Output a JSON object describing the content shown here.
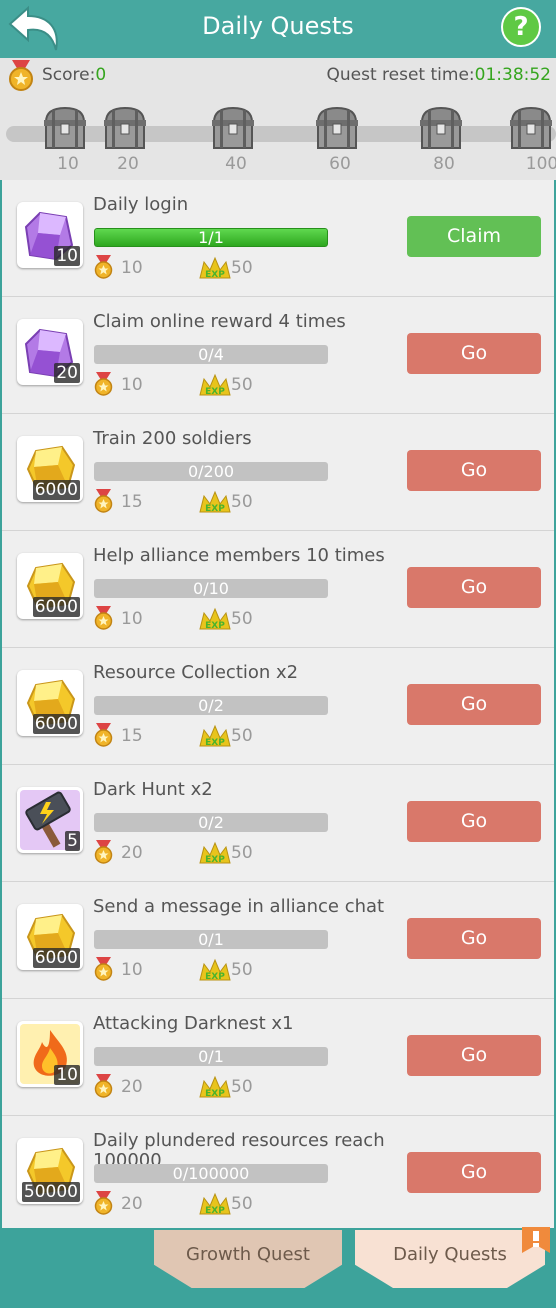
{
  "header": {
    "title": "Daily Quests",
    "help_label": "?"
  },
  "scorebar": {
    "score_label": "Score:",
    "score_value": "0",
    "reset_label": "Quest reset time:",
    "reset_time": "01:38:52"
  },
  "milestones": [
    "10",
    "20",
    "40",
    "60",
    "80",
    "100"
  ],
  "quests": [
    {
      "name": "Daily login",
      "progress": "1/1",
      "progress_fraction": 1,
      "score": "10",
      "exp": "50",
      "reward_icon": "purple-crystal-icon",
      "reward_qty": "10",
      "button": "Claim"
    },
    {
      "name": "Claim online reward 4 times",
      "progress": "0/4",
      "progress_fraction": 0,
      "score": "10",
      "exp": "50",
      "reward_icon": "purple-crystal-icon",
      "reward_qty": "20",
      "button": "Go"
    },
    {
      "name": "Train 200 soldiers",
      "progress": "0/200",
      "progress_fraction": 0,
      "score": "15",
      "exp": "50",
      "reward_icon": "gold-ore-icon",
      "reward_qty": "6000",
      "button": "Go"
    },
    {
      "name": "Help alliance members 10 times",
      "progress": "0/10",
      "progress_fraction": 0,
      "score": "10",
      "exp": "50",
      "reward_icon": "gold-ore-icon",
      "reward_qty": "6000",
      "button": "Go"
    },
    {
      "name": "Resource Collection x2",
      "progress": "0/2",
      "progress_fraction": 0,
      "score": "15",
      "exp": "50",
      "reward_icon": "gold-ore-icon",
      "reward_qty": "6000",
      "button": "Go"
    },
    {
      "name": "Dark Hunt x2",
      "progress": "0/2",
      "progress_fraction": 0,
      "score": "20",
      "exp": "50",
      "reward_icon": "hammer-icon",
      "reward_qty": "5",
      "button": "Go"
    },
    {
      "name": "Send a message in alliance chat",
      "progress": "0/1",
      "progress_fraction": 0,
      "score": "10",
      "exp": "50",
      "reward_icon": "gold-ore-icon",
      "reward_qty": "6000",
      "button": "Go"
    },
    {
      "name": "Attacking Darknest x1",
      "progress": "0/1",
      "progress_fraction": 0,
      "score": "20",
      "exp": "50",
      "reward_icon": "fire-icon",
      "reward_qty": "10",
      "button": "Go"
    },
    {
      "name": "Daily plundered resources reach 100000",
      "progress": "0/100000",
      "progress_fraction": 0,
      "score": "20",
      "exp": "50",
      "reward_icon": "gold-ore-icon",
      "reward_qty": "50000",
      "button": "Go"
    }
  ],
  "tabs": [
    {
      "label": "Growth Quest",
      "active": false
    },
    {
      "label": "Daily Quests",
      "active": true
    }
  ],
  "colors": {
    "header": "#47a8a0",
    "accent_green": "#35a51e",
    "go_button": "#d9786a",
    "claim_button": "#62c055"
  }
}
